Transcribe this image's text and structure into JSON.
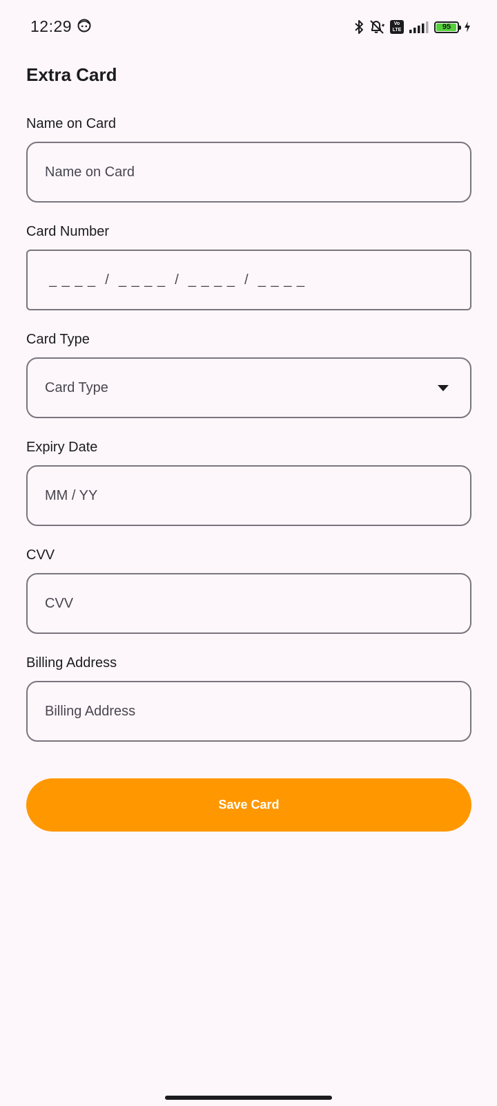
{
  "status_bar": {
    "time": "12:29",
    "battery_level": "95",
    "volte_top": "Vo",
    "volte_bottom": "LTE",
    "icons": [
      "face-icon",
      "bluetooth-icon",
      "vibrate-off-icon",
      "volte-icon",
      "signal-icon",
      "battery-icon",
      "charging-icon"
    ]
  },
  "page": {
    "title": "Extra Card"
  },
  "form": {
    "name": {
      "label": "Name on Card",
      "placeholder": "Name on Card"
    },
    "card_number": {
      "label": "Card Number",
      "placeholder": "_ _ _ _  /  _ _ _ _  /  _ _ _ _  /  _ _ _ _"
    },
    "card_type": {
      "label": "Card Type",
      "selected": "Card Type"
    },
    "expiry": {
      "label": "Expiry Date",
      "placeholder": "MM / YY"
    },
    "cvv": {
      "label": "CVV",
      "placeholder": "CVV"
    },
    "billing": {
      "label": "Billing Address",
      "placeholder": "Billing Address"
    }
  },
  "actions": {
    "save_label": "Save Card"
  },
  "colors": {
    "background": "#fdf7fb",
    "accent": "#ff9800",
    "border": "#79747e",
    "battery": "#54d13a"
  }
}
